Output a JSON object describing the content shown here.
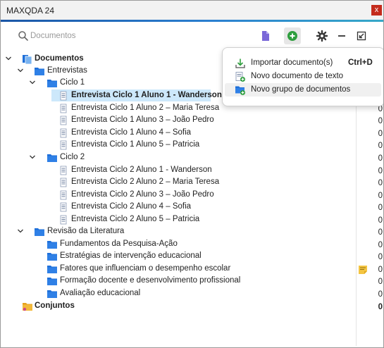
{
  "window": {
    "title": "MAXQDA 24",
    "close_label": "x"
  },
  "search": {
    "placeholder": "Documentos"
  },
  "toolbar": {
    "icons": [
      "document-set-icon",
      "add-icon",
      "gear-icon",
      "minimize-icon",
      "undock-icon"
    ]
  },
  "menu": {
    "items": [
      {
        "label": "Importar documento(s)",
        "shortcut": "Ctrl+D",
        "icon": "import-icon"
      },
      {
        "label": "Novo documento de texto",
        "shortcut": "",
        "icon": "new-text-document-icon"
      },
      {
        "label": "Novo grupo de documentos",
        "shortcut": "",
        "icon": "new-document-group-icon"
      }
    ]
  },
  "tree": {
    "root": "Documentos",
    "group_entrevistas": "Entrevistas",
    "ciclo1": {
      "label": "Ciclo 1",
      "docs": [
        "Entrevista Ciclo 1 Aluno 1 - Wanderson",
        "Entrevista Ciclo 1 Aluno 2 – Maria Teresa",
        "Entrevista Ciclo 1 Aluno 3 – João Pedro",
        "Entrevista Ciclo 1 Aluno 4 – Sofia",
        "Entrevista Ciclo 1 Aluno 5 – Patricia"
      ]
    },
    "ciclo2": {
      "label": "Ciclo 2",
      "docs": [
        "Entrevista Ciclo 2 Aluno 1 - Wanderson",
        "Entrevista Ciclo 2 Aluno 2 – Maria Teresa",
        "Entrevista Ciclo 2 Aluno 3 – João Pedro",
        "Entrevista Ciclo 2 Aluno 4 – Sofia",
        "Entrevista Ciclo 2 Aluno 5 – Patricia"
      ]
    },
    "revisao": {
      "label": "Revisão da Literatura",
      "folders": [
        "Fundamentos da Pesquisa-Ação",
        "Estratégias de intervenção educacional",
        "Fatores que influenciam o desempenho escolar",
        "Formação docente e desenvolvimento profissional",
        "Avaliação educacional"
      ]
    },
    "conjuntos": "Conjuntos"
  },
  "counts": {
    "ciclo1_docs": [
      "0"
    ],
    "visible": [
      "0",
      "0",
      "0",
      "0",
      "0",
      "0",
      "0",
      "0",
      "0",
      "0",
      "0",
      "0",
      "0",
      "0",
      "0",
      "0",
      "0",
      "0"
    ],
    "conjuntos": "0"
  },
  "colors": {
    "accent": "#1a56a6",
    "folder": "#1e6fd9",
    "selection": "#cde8fb",
    "add_green": "#2e9e3e",
    "close_red": "#c42b1c"
  }
}
